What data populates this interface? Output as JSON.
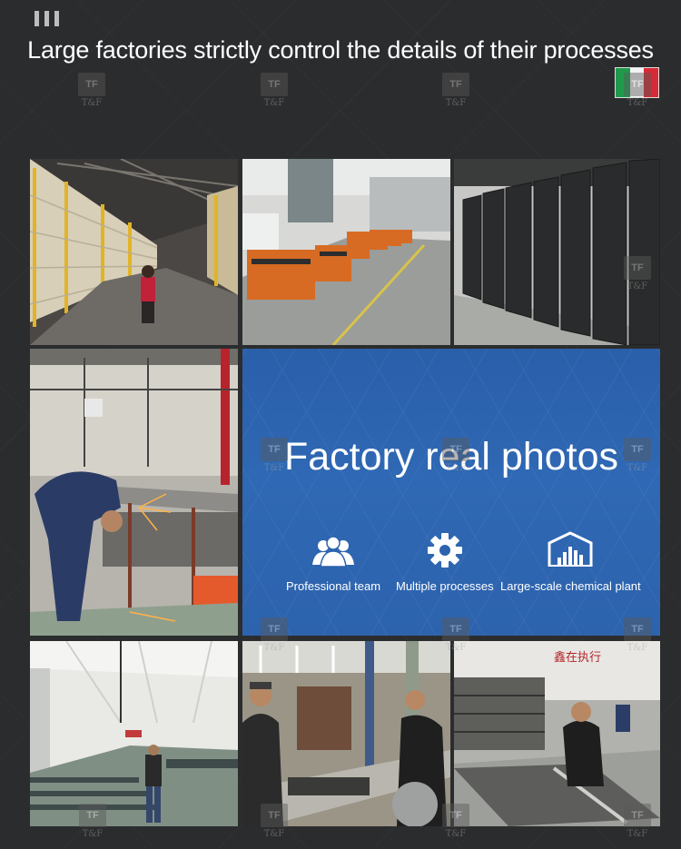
{
  "header": {
    "headline": "Large factories strictly control the details of their processes",
    "flag": "italy-flag",
    "menu_icon": "menu-bars-icon"
  },
  "watermark": {
    "mark": "TF",
    "text": "T&F"
  },
  "photos": [
    {
      "name": "warehouse-racks-photo",
      "description_icon": "photo"
    },
    {
      "name": "production-line-photo",
      "description_icon": "photo"
    },
    {
      "name": "finished-doors-photo",
      "description_icon": "photo"
    },
    {
      "name": "welding-worker-photo",
      "description_icon": "photo"
    },
    {
      "name": "workshop-hall-photo",
      "description_icon": "photo"
    },
    {
      "name": "assembly-workers-photo",
      "description_icon": "photo"
    },
    {
      "name": "frame-assembly-photo",
      "description_icon": "photo"
    }
  ],
  "banner": {
    "title": "Factory real photos",
    "features": [
      {
        "label": "Professional team",
        "icon": "team-icon"
      },
      {
        "label": "Multiple processes",
        "icon": "gear-icon"
      },
      {
        "label": "Large-scale chemical plant",
        "icon": "factory-icon"
      }
    ],
    "color": "#2d63ad"
  },
  "photo_sign_text": "鑫在执行"
}
